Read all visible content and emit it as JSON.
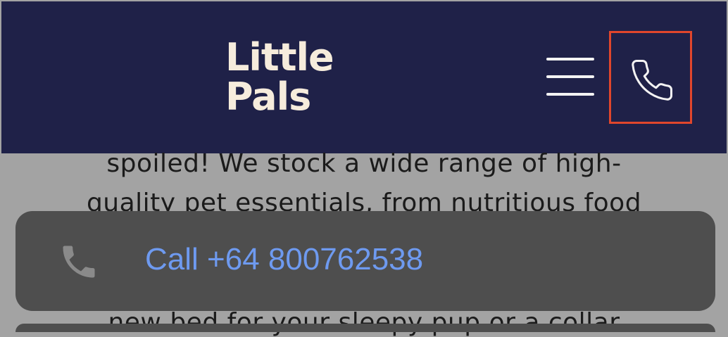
{
  "header": {
    "logo_line1": "Little",
    "logo_line2": "Pals"
  },
  "icons": {
    "menu": "hamburger-menu-icon",
    "phone": "phone-icon"
  },
  "content": {
    "line1": "spoiled! We stock a wide range of high-",
    "line2": "quality pet essentials, from nutritious food",
    "line3": "new bed for your sleepy pup or a collar"
  },
  "call_sheet": {
    "label": "Call +64 800762538"
  },
  "colors": {
    "header_bg": "#1f2148",
    "logo": "#f6ecdc",
    "highlight_border": "#e0462c",
    "call_link": "#6e9af0",
    "sheet_bg": "#4e4e4e",
    "overlay_bg": "#a3a3a3"
  }
}
